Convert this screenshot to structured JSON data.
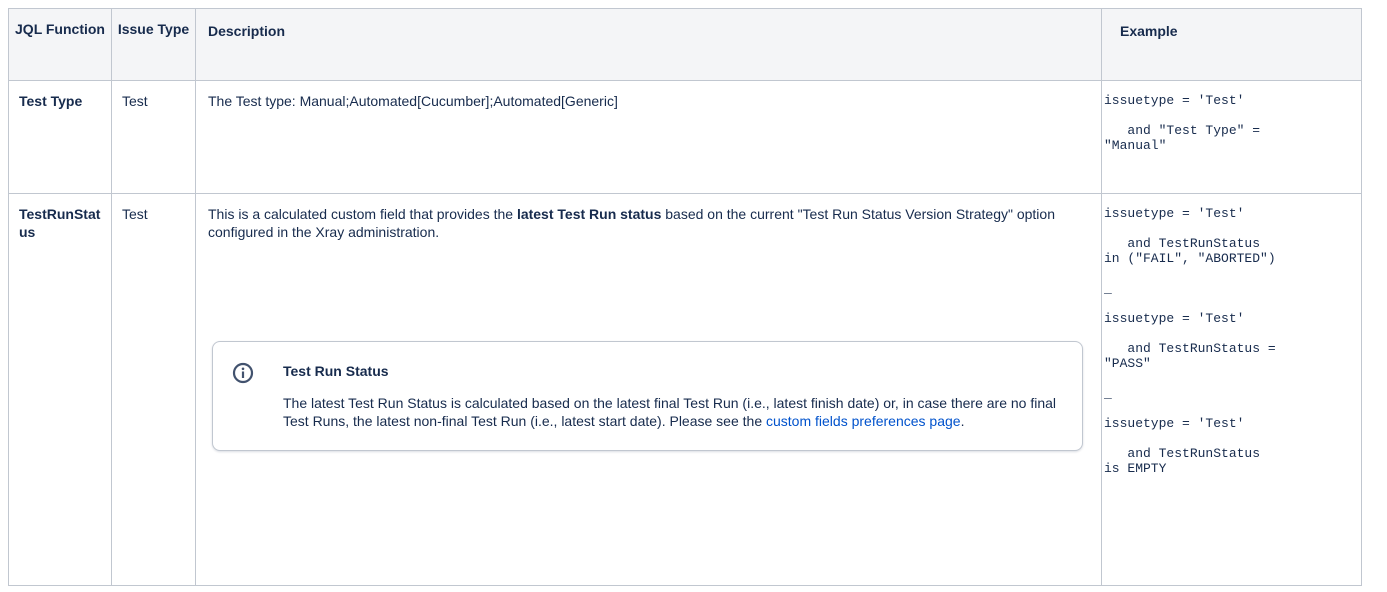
{
  "headers": {
    "jql_function": "JQL Function",
    "issue_type": "Issue Type",
    "description": "Description",
    "example": "Example"
  },
  "rows": [
    {
      "name": "Test Type",
      "issue_type": "Test",
      "description": "The Test type: Manual;Automated[Cucumber];Automated[Generic]",
      "example": "issuetype = 'Test'\n\n   and \"Test Type\" =\n\"Manual\""
    },
    {
      "name": "TestRunStatus",
      "issue_type": "Test",
      "description_pre": "This is a calculated custom field that provides the ",
      "description_bold": "latest Test Run status",
      "description_post": " based on the current \"Test Run Status Version Strategy\" option configured in the Xray administration.",
      "info_panel": {
        "icon": "info-icon",
        "title": "Test Run Status",
        "text": "The latest Test Run Status is calculated based on the latest final Test Run (i.e., latest finish date) or, in case there are no final Test Runs, the latest non-final Test Run (i.e., latest start date). Please see the ",
        "link_text": "custom fields preferences page",
        "text_end": "."
      },
      "example": "issuetype = 'Test'\n\n   and TestRunStatus\nin (\"FAIL\", \"ABORTED\")\n\n_\n\nissuetype = 'Test'\n\n   and TestRunStatus =\n\"PASS\"\n\n_\n\nissuetype = 'Test'\n\n   and TestRunStatus\nis EMPTY"
    }
  ]
}
